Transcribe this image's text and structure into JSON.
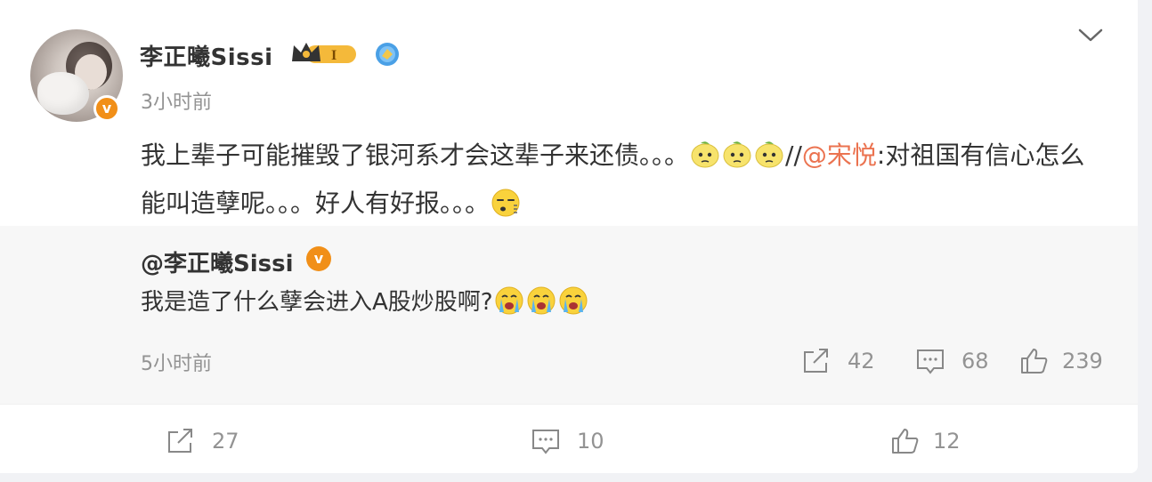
{
  "post": {
    "username": "李正曦Sissi",
    "time": "3小时前",
    "text_part1": "我上辈子可能摧毁了银河系才会这辈子来还债。。。",
    "separator": "//",
    "mention": "@宋悦",
    "text_part2": ":对祖国有信心怎么能叫造孽呢。。。好人有好报。。。",
    "icons": [
      "crown-level-badge",
      "blue-medal-icon",
      "chevron-down-icon",
      "verified-v-badge"
    ],
    "level_label": "I",
    "verified_label": "v"
  },
  "repost": {
    "username": "@李正曦Sissi",
    "text": "我是造了什么孽会进入A股炒股啊?",
    "time": "5小时前",
    "share_count": "42",
    "comment_count": "68",
    "like_count": "239"
  },
  "actions": {
    "share_count": "27",
    "comment_count": "10",
    "like_count": "12"
  },
  "colors": {
    "mention": "#eb7350",
    "verified": "#f18f18",
    "muted": "#939393",
    "text": "#333333"
  }
}
